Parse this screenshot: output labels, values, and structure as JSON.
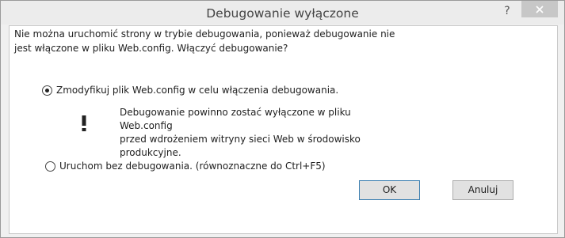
{
  "window": {
    "title": "Debugowanie wyłączone",
    "help_label": "?",
    "close_icon": "close-icon"
  },
  "message": {
    "line1": "Nie można uruchomić strony w trybie debugowania, ponieważ debugowanie nie",
    "line2": "jest włączone w pliku Web.config. Włączyć debugowanie?"
  },
  "options": [
    {
      "label": "Zmodyfikuj plik Web.config w celu włączenia debugowania.",
      "checked": true
    },
    {
      "label": "Uruchom bez debugowania. (równoznaczne do Ctrl+F5)",
      "checked": false
    }
  ],
  "warning": {
    "icon": "warning-icon",
    "line1": "Debugowanie powinno zostać wyłączone w pliku Web.config",
    "line2": "przed wdrożeniem witryny sieci Web w środowisko",
    "line3": "produkcyjne."
  },
  "buttons": {
    "ok_label": "OK",
    "cancel_label": "Anuluj"
  },
  "colors": {
    "close_button_bg": "#c7c7c7",
    "dialog_bg": "#f0f0f0",
    "client_bg": "#ffffff",
    "default_button_border": "#3c7fb1"
  }
}
